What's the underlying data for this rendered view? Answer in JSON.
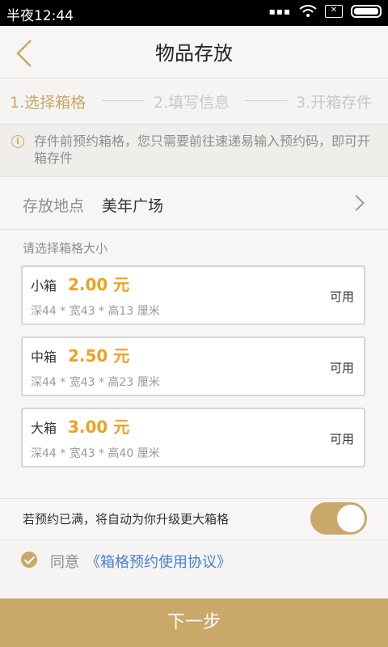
{
  "status_bar": {
    "time": "半夜12:44"
  },
  "header": {
    "title": "物品存放"
  },
  "steps": [
    "1.选择箱格",
    "2.填写信息",
    "3.开箱存件"
  ],
  "notice": "存件前预约箱格，您只需要前往速递易输入预约码，即可开箱存件",
  "location": {
    "label": "存放地点",
    "value": "美年广场"
  },
  "box_section_label": "请选择箱格大小",
  "boxes": [
    {
      "name": "小箱",
      "price": "2.00 元",
      "dims": "深44 * 宽43 * 高13 厘米",
      "status": "可用"
    },
    {
      "name": "中箱",
      "price": "2.50 元",
      "dims": "深44 * 宽43 * 高23 厘米",
      "status": "可用"
    },
    {
      "name": "大箱",
      "price": "3.00 元",
      "dims": "深44 * 宽43 * 高40 厘米",
      "status": "可用"
    }
  ],
  "upgrade": {
    "text": "若预约已满，将自动为你升级更大箱格",
    "enabled": true
  },
  "agreement": {
    "prefix": "同意",
    "link": "《箱格预约使用协议》",
    "checked": true
  },
  "next_button": "下一步",
  "colors": {
    "accent": "#c9a86a",
    "price": "#f0a21e",
    "link": "#4a7fd6"
  }
}
